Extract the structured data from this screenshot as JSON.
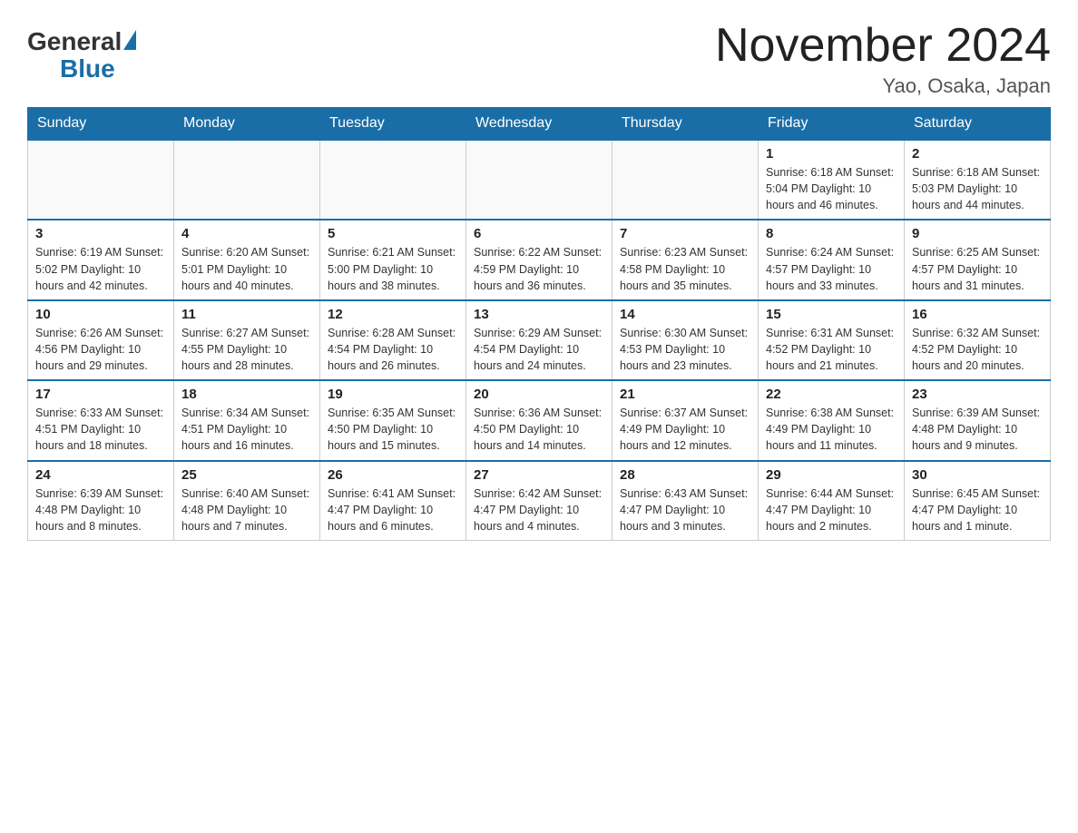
{
  "header": {
    "title": "November 2024",
    "location": "Yao, Osaka, Japan",
    "logo_general": "General",
    "logo_blue": "Blue"
  },
  "days_of_week": [
    "Sunday",
    "Monday",
    "Tuesday",
    "Wednesday",
    "Thursday",
    "Friday",
    "Saturday"
  ],
  "weeks": [
    [
      {
        "day": "",
        "info": ""
      },
      {
        "day": "",
        "info": ""
      },
      {
        "day": "",
        "info": ""
      },
      {
        "day": "",
        "info": ""
      },
      {
        "day": "",
        "info": ""
      },
      {
        "day": "1",
        "info": "Sunrise: 6:18 AM\nSunset: 5:04 PM\nDaylight: 10 hours and 46 minutes."
      },
      {
        "day": "2",
        "info": "Sunrise: 6:18 AM\nSunset: 5:03 PM\nDaylight: 10 hours and 44 minutes."
      }
    ],
    [
      {
        "day": "3",
        "info": "Sunrise: 6:19 AM\nSunset: 5:02 PM\nDaylight: 10 hours and 42 minutes."
      },
      {
        "day": "4",
        "info": "Sunrise: 6:20 AM\nSunset: 5:01 PM\nDaylight: 10 hours and 40 minutes."
      },
      {
        "day": "5",
        "info": "Sunrise: 6:21 AM\nSunset: 5:00 PM\nDaylight: 10 hours and 38 minutes."
      },
      {
        "day": "6",
        "info": "Sunrise: 6:22 AM\nSunset: 4:59 PM\nDaylight: 10 hours and 36 minutes."
      },
      {
        "day": "7",
        "info": "Sunrise: 6:23 AM\nSunset: 4:58 PM\nDaylight: 10 hours and 35 minutes."
      },
      {
        "day": "8",
        "info": "Sunrise: 6:24 AM\nSunset: 4:57 PM\nDaylight: 10 hours and 33 minutes."
      },
      {
        "day": "9",
        "info": "Sunrise: 6:25 AM\nSunset: 4:57 PM\nDaylight: 10 hours and 31 minutes."
      }
    ],
    [
      {
        "day": "10",
        "info": "Sunrise: 6:26 AM\nSunset: 4:56 PM\nDaylight: 10 hours and 29 minutes."
      },
      {
        "day": "11",
        "info": "Sunrise: 6:27 AM\nSunset: 4:55 PM\nDaylight: 10 hours and 28 minutes."
      },
      {
        "day": "12",
        "info": "Sunrise: 6:28 AM\nSunset: 4:54 PM\nDaylight: 10 hours and 26 minutes."
      },
      {
        "day": "13",
        "info": "Sunrise: 6:29 AM\nSunset: 4:54 PM\nDaylight: 10 hours and 24 minutes."
      },
      {
        "day": "14",
        "info": "Sunrise: 6:30 AM\nSunset: 4:53 PM\nDaylight: 10 hours and 23 minutes."
      },
      {
        "day": "15",
        "info": "Sunrise: 6:31 AM\nSunset: 4:52 PM\nDaylight: 10 hours and 21 minutes."
      },
      {
        "day": "16",
        "info": "Sunrise: 6:32 AM\nSunset: 4:52 PM\nDaylight: 10 hours and 20 minutes."
      }
    ],
    [
      {
        "day": "17",
        "info": "Sunrise: 6:33 AM\nSunset: 4:51 PM\nDaylight: 10 hours and 18 minutes."
      },
      {
        "day": "18",
        "info": "Sunrise: 6:34 AM\nSunset: 4:51 PM\nDaylight: 10 hours and 16 minutes."
      },
      {
        "day": "19",
        "info": "Sunrise: 6:35 AM\nSunset: 4:50 PM\nDaylight: 10 hours and 15 minutes."
      },
      {
        "day": "20",
        "info": "Sunrise: 6:36 AM\nSunset: 4:50 PM\nDaylight: 10 hours and 14 minutes."
      },
      {
        "day": "21",
        "info": "Sunrise: 6:37 AM\nSunset: 4:49 PM\nDaylight: 10 hours and 12 minutes."
      },
      {
        "day": "22",
        "info": "Sunrise: 6:38 AM\nSunset: 4:49 PM\nDaylight: 10 hours and 11 minutes."
      },
      {
        "day": "23",
        "info": "Sunrise: 6:39 AM\nSunset: 4:48 PM\nDaylight: 10 hours and 9 minutes."
      }
    ],
    [
      {
        "day": "24",
        "info": "Sunrise: 6:39 AM\nSunset: 4:48 PM\nDaylight: 10 hours and 8 minutes."
      },
      {
        "day": "25",
        "info": "Sunrise: 6:40 AM\nSunset: 4:48 PM\nDaylight: 10 hours and 7 minutes."
      },
      {
        "day": "26",
        "info": "Sunrise: 6:41 AM\nSunset: 4:47 PM\nDaylight: 10 hours and 6 minutes."
      },
      {
        "day": "27",
        "info": "Sunrise: 6:42 AM\nSunset: 4:47 PM\nDaylight: 10 hours and 4 minutes."
      },
      {
        "day": "28",
        "info": "Sunrise: 6:43 AM\nSunset: 4:47 PM\nDaylight: 10 hours and 3 minutes."
      },
      {
        "day": "29",
        "info": "Sunrise: 6:44 AM\nSunset: 4:47 PM\nDaylight: 10 hours and 2 minutes."
      },
      {
        "day": "30",
        "info": "Sunrise: 6:45 AM\nSunset: 4:47 PM\nDaylight: 10 hours and 1 minute."
      }
    ]
  ]
}
